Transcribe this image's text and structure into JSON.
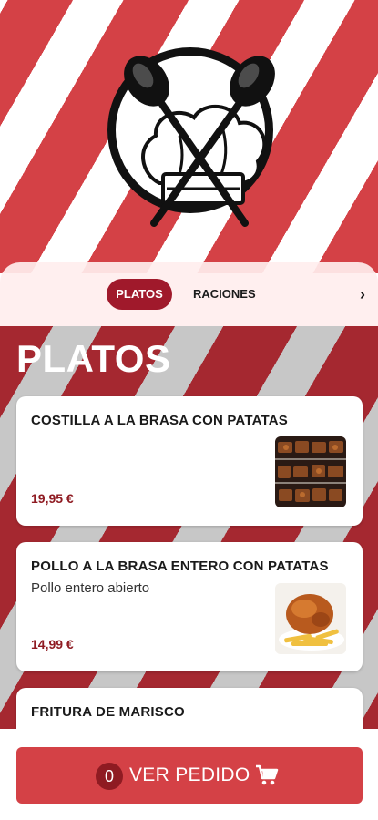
{
  "brand": {
    "logo_icon": "chef-hat-crossed-spoons-logo"
  },
  "tabs": {
    "active_label": "PLATOS",
    "items": [
      "PLATOS",
      "RACIONES"
    ],
    "next_icon": "chevron-right-icon"
  },
  "section": {
    "title": "PLATOS"
  },
  "dishes": [
    {
      "name": "COSTILLA A LA BRASA CON PATATAS",
      "description": "",
      "price": "19,95 €",
      "image": "grilled-ribs-photo"
    },
    {
      "name": "POLLO A LA BRASA ENTERO CON PATATAS",
      "description": "Pollo entero abierto",
      "price": "14,99 €",
      "image": "roast-chicken-fries-photo"
    },
    {
      "name": "FRITURA DE MARISCO",
      "description": "",
      "price": "",
      "image": ""
    }
  ],
  "order": {
    "count": "0",
    "label": "VER PEDIDO",
    "icon": "cart-icon"
  },
  "colors": {
    "accent": "#d44146",
    "dark_red": "#a0192b",
    "price": "#8f1b22"
  }
}
